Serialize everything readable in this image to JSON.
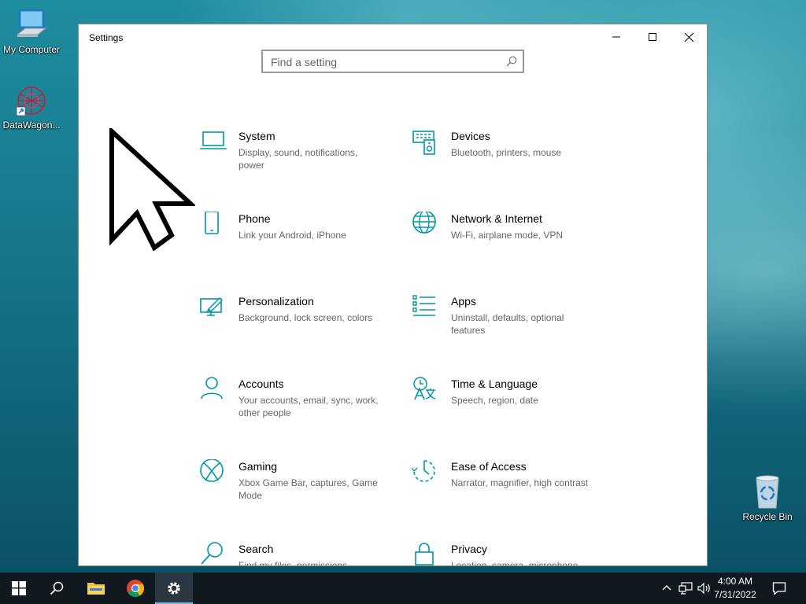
{
  "desktop": {
    "icons": [
      {
        "label": "My Computer"
      },
      {
        "label": "DataWagon..."
      },
      {
        "label": "Recycle Bin"
      }
    ]
  },
  "window": {
    "title": "Settings",
    "search": {
      "placeholder": "Find a setting"
    },
    "accent_color": "#0096a8",
    "categories": [
      {
        "name": "System",
        "desc": "Display, sound, notifications, power",
        "icon": "laptop-icon"
      },
      {
        "name": "Devices",
        "desc": "Bluetooth, printers, mouse",
        "icon": "devices-icon"
      },
      {
        "name": "Phone",
        "desc": "Link your Android, iPhone",
        "icon": "phone-icon"
      },
      {
        "name": "Network & Internet",
        "desc": "Wi-Fi, airplane mode, VPN",
        "icon": "globe-icon"
      },
      {
        "name": "Personalization",
        "desc": "Background, lock screen, colors",
        "icon": "paintbrush-icon"
      },
      {
        "name": "Apps",
        "desc": "Uninstall, defaults, optional features",
        "icon": "apps-list-icon"
      },
      {
        "name": "Accounts",
        "desc": "Your accounts, email, sync, work, other people",
        "icon": "person-icon"
      },
      {
        "name": "Time & Language",
        "desc": "Speech, region, date",
        "icon": "time-language-icon"
      },
      {
        "name": "Gaming",
        "desc": "Xbox Game Bar, captures, Game Mode",
        "icon": "xbox-icon"
      },
      {
        "name": "Ease of Access",
        "desc": "Narrator, magnifier, high contrast",
        "icon": "ease-of-access-icon"
      },
      {
        "name": "Search",
        "desc": "Find my files, permissions",
        "icon": "search-icon"
      },
      {
        "name": "Privacy",
        "desc": "Location, camera, microphone",
        "icon": "lock-icon"
      }
    ]
  },
  "taskbar": {
    "time": "4:00 AM",
    "date": "7/31/2022"
  }
}
